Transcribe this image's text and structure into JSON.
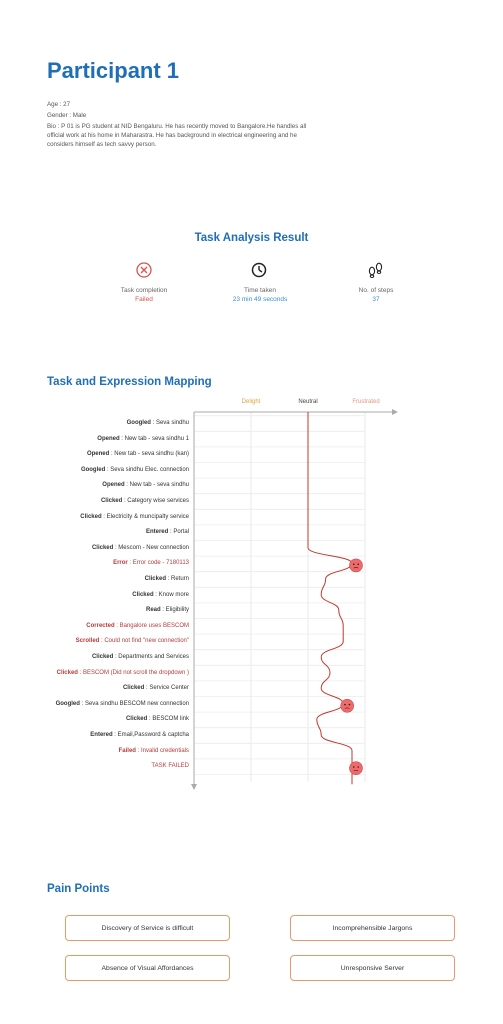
{
  "title": "Participant 1",
  "profile": {
    "age": "Age : 27",
    "gender": "Gender : Male",
    "bio_line1": "Bio :  P 01 is PG student at NID Bengaluru. He has recently moved to Bangalore.He handles all",
    "bio_line2": "official work at his home in Maharastra. He has background in electrical engineering and he",
    "bio_line3": "considers himself as tech savvy person."
  },
  "task_analysis": {
    "title": "Task Analysis Result",
    "metrics": [
      {
        "label": "Task completion",
        "value": "Failed",
        "icon": "x-circle-icon",
        "color": "#d9534f"
      },
      {
        "label": "Time taken",
        "value": "23 min 49 seconds",
        "icon": "clock-icon",
        "color": "#3a8fd0"
      },
      {
        "label": "No. of steps",
        "value": "37",
        "icon": "footprints-icon",
        "color": "#3a8fd0"
      }
    ]
  },
  "mapping": {
    "title": "Task and Expression Mapping",
    "columns": [
      {
        "label": "Delight",
        "color": "#d9a441"
      },
      {
        "label": "Neutral",
        "color": "#444444"
      },
      {
        "label": "Frustrated",
        "color": "#e8967a"
      }
    ],
    "steps": [
      {
        "action": "Googled",
        "detail": " : Seva sindhu",
        "error": false
      },
      {
        "action": "Opened",
        "detail": " : New tab - seva sindhu 1",
        "error": false
      },
      {
        "action": "Opened",
        "detail": " : New tab - seva sindhu (kan)",
        "error": false
      },
      {
        "action": "Googled",
        "detail": " : Seva sindhu Elec. connection",
        "error": false
      },
      {
        "action": "Opened",
        "detail": " : New tab - seva sindhu",
        "error": false
      },
      {
        "action": "Clicked",
        "detail": " : Category wise services",
        "error": false
      },
      {
        "action": "Clicked",
        "detail": " : Electricity & muncipalty service",
        "error": false
      },
      {
        "action": "Entered",
        "detail": " : Portal",
        "error": false
      },
      {
        "action": "Clicked",
        "detail": " : Mescom - New connection",
        "error": false
      },
      {
        "action": "Error",
        "detail": " : Error code - 7180113",
        "error": true
      },
      {
        "action": "Clicked",
        "detail": " : Return",
        "error": false
      },
      {
        "action": "Clicked",
        "detail": " : Know more",
        "error": false
      },
      {
        "action": "Read",
        "detail": " : Eligibility",
        "error": false
      },
      {
        "action": "Corrected",
        "detail": " : Bangalore uses BESCOM",
        "error": true
      },
      {
        "action": "Scrolled",
        "detail": " : Could not find \"new connection\"",
        "error": true
      },
      {
        "action": "Clicked",
        "detail": " : Departments and Services",
        "error": false
      },
      {
        "action": "Clicked",
        "detail": " : BESCOM (Did not scroll the dropdown )",
        "error": true
      },
      {
        "action": "Clicked",
        "detail": " : Service Center",
        "error": false
      },
      {
        "action": "Googled",
        "detail": " : Seva sindhu BESCOM new connection",
        "error": false
      },
      {
        "action": "Clicked",
        "detail": " : BESCOM link",
        "error": false
      },
      {
        "action": "Entered",
        "detail": " : Email,Password & captcha",
        "error": false
      },
      {
        "action": "Failed",
        "detail": " : Invalid credentials",
        "error": true
      },
      {
        "action": "",
        "detail": "TASK FAILED",
        "error": true
      }
    ],
    "expression_levels": [
      0,
      0,
      0,
      0,
      0,
      0,
      0,
      0,
      0,
      1,
      0.4,
      0.3,
      0.7,
      0.8,
      0.8,
      0.3,
      0.5,
      0.3,
      0.8,
      0.2,
      0.3,
      1,
      1
    ],
    "frustrated_faces_at": [
      9,
      18,
      22
    ]
  },
  "pain_points": {
    "title": "Pain Points",
    "items": [
      "Discovery of Service is difficult",
      "Incomprehensible Jargons",
      "Absence of  Visual Affordances",
      "Unresponsive Server"
    ]
  }
}
